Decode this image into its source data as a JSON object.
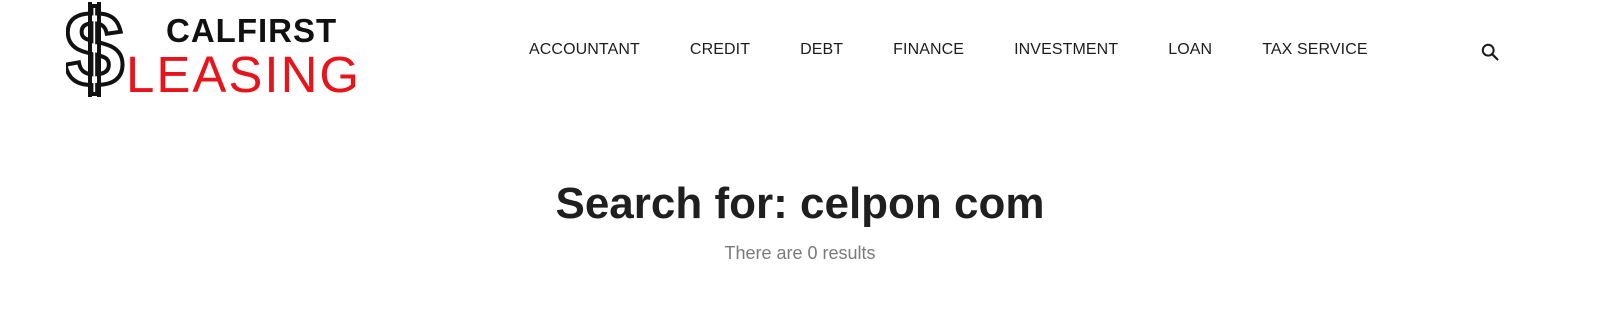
{
  "brand": {
    "line1": "CALFIRST",
    "line2": "LEASING",
    "accent_color": "#e8141c",
    "text_color": "#111111",
    "symbol": "$"
  },
  "nav": {
    "items": [
      {
        "label": "ACCOUNTANT"
      },
      {
        "label": "CREDIT"
      },
      {
        "label": "DEBT"
      },
      {
        "label": "FINANCE"
      },
      {
        "label": "INVESTMENT"
      },
      {
        "label": "LOAN"
      },
      {
        "label": "TAX SERVICE"
      }
    ],
    "search_icon": "search-icon"
  },
  "main": {
    "title": "Search for: celpon com",
    "results_text": "There are 0 results"
  }
}
